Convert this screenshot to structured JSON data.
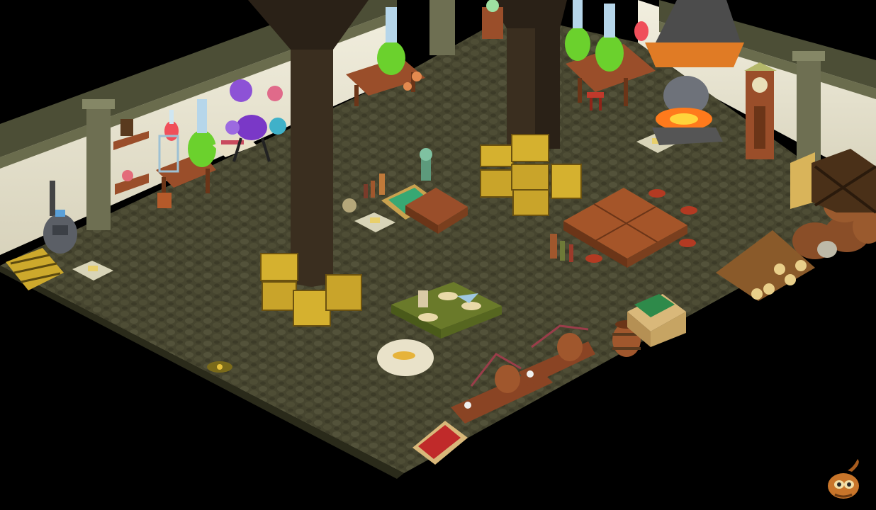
{
  "scene": {
    "colors": {
      "background": "#000000",
      "floor": "#46452f",
      "cobble_dark": "#35341f",
      "wall": "#e6e2cf",
      "trim": "#5a5b40",
      "beam": "#2a2117",
      "wood": "#9a4e2a",
      "wood_dark": "#6b3518",
      "hay": "#d5b12f",
      "potion_green": "#6bd12d",
      "potion_purple": "#7a38c7",
      "fire": "#ff7a1c"
    },
    "objects": [
      "stove-icon",
      "firewood-pile-icon",
      "floor-hatch-icon",
      "alchemy-station-left",
      "purple-cauldron-icon",
      "hay-bale-stack-left",
      "green-alchemy-table",
      "flour-sack-icon",
      "alchemy-benches",
      "barrel-icon",
      "bottle-crate-icon",
      "meat-crate-icon",
      "wooden-tables-right",
      "red-stools",
      "hay-bale-stack-center",
      "water-trough-icon",
      "potion-stand-top",
      "forge-icon",
      "grandfather-clock-icon",
      "barrel-stack-icon",
      "log-pile-icon",
      "wooden-crates-icon",
      "support-pillars"
    ]
  },
  "hud": {
    "character_icon": "character-portrait-icon"
  }
}
